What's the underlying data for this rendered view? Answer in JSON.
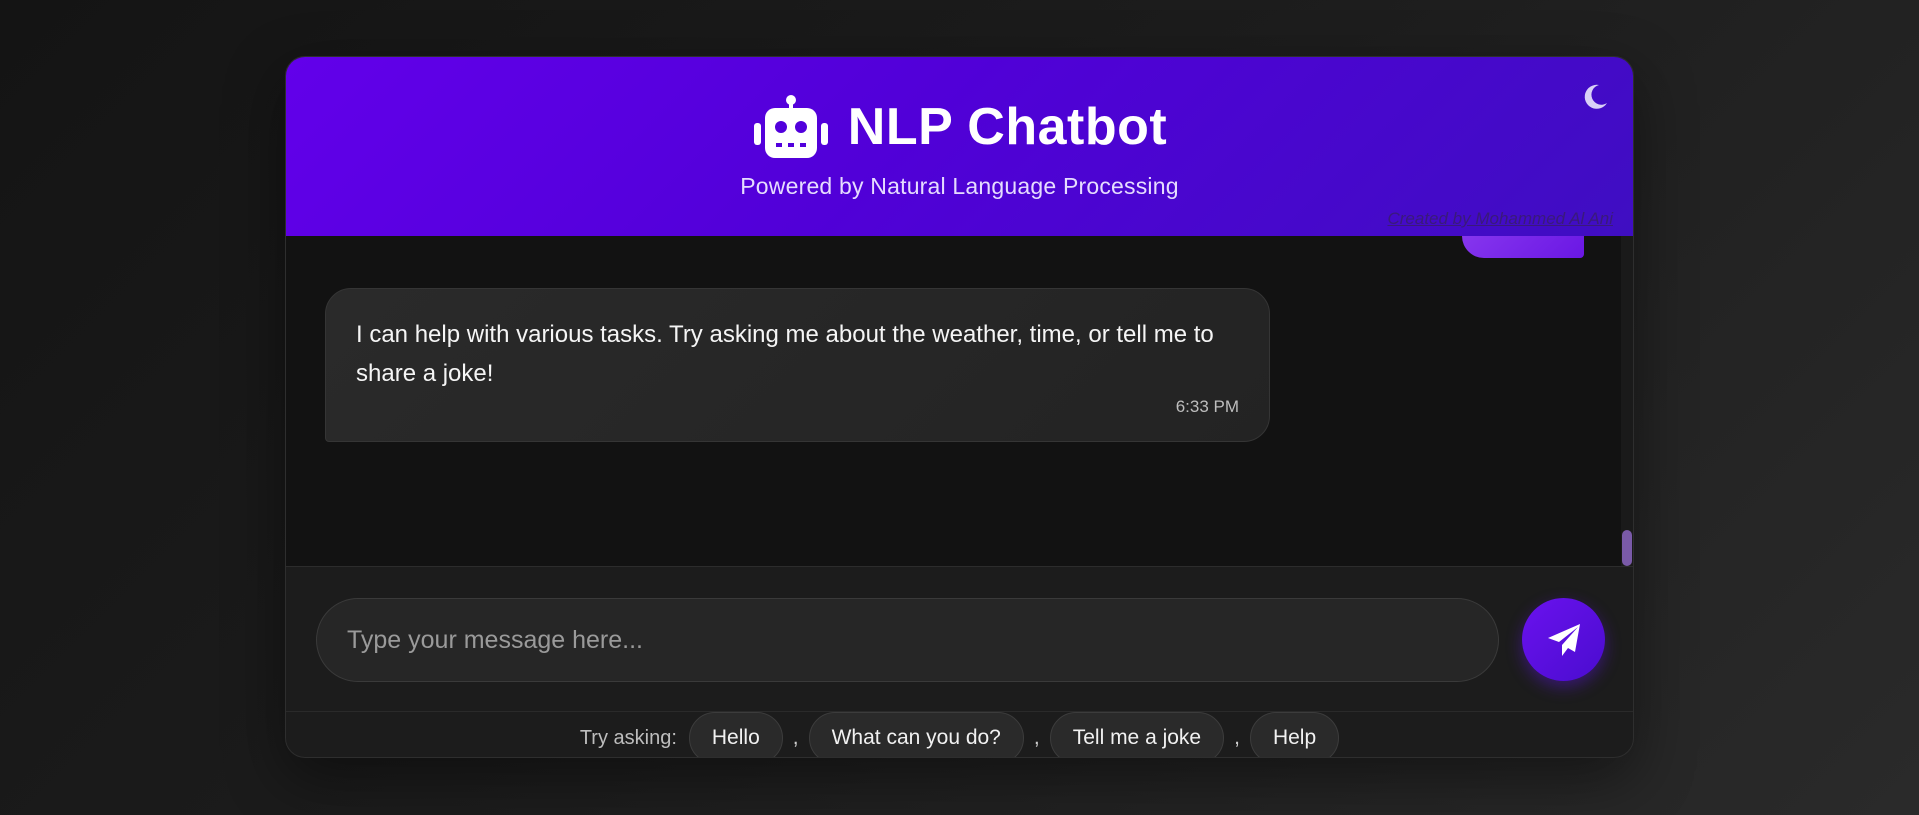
{
  "header": {
    "title": "NLP Chatbot",
    "subtitle": "Powered by Natural Language Processing",
    "credit": "Created by Mohammed Al Ani",
    "robot_icon": "robot-icon",
    "theme_icon": "moon-icon"
  },
  "messages": [
    {
      "sender": "bot",
      "text": "I can help with various tasks. Try asking me about the weather, time, or tell me to share a joke!",
      "time": "6:33 PM"
    }
  ],
  "input": {
    "placeholder": "Type your message here...",
    "value": "",
    "send_icon": "paper-plane-icon"
  },
  "suggestions": {
    "label": "Try asking:",
    "items": [
      "Hello",
      "What can you do?",
      "Tell me a joke",
      "Help"
    ],
    "separator": ","
  },
  "colors": {
    "accent": "#6200ea",
    "accent_dark": "#3f0ec2",
    "user_bubble": "#7b2bee",
    "background": "#121212"
  }
}
